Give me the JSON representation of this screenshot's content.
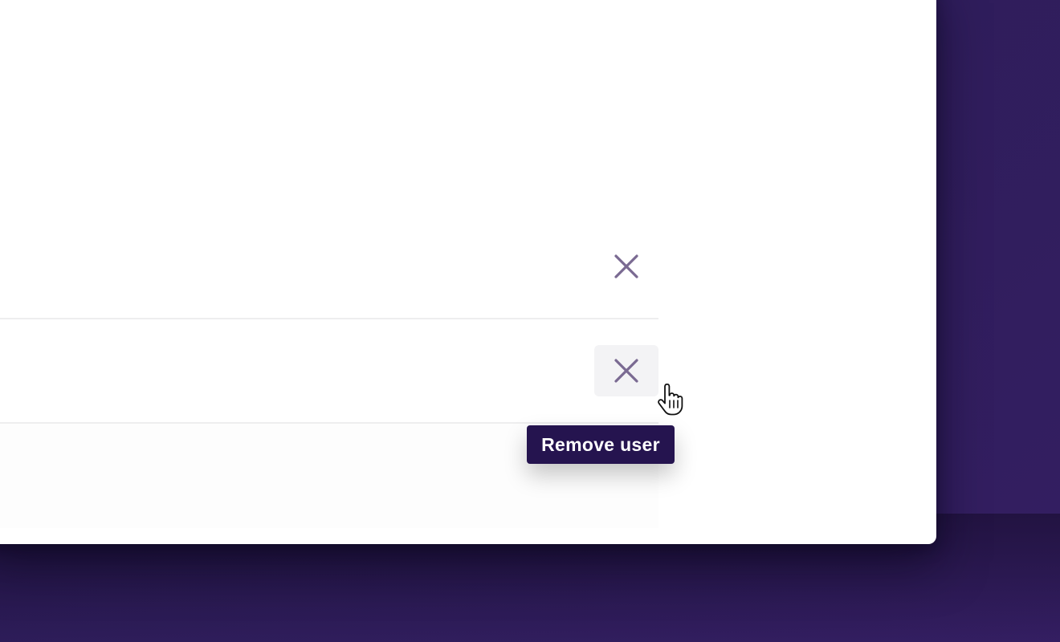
{
  "users_list": {
    "rows": [
      {
        "remove_icon": "close-icon"
      },
      {
        "remove_icon": "close-icon",
        "hovered": true
      }
    ]
  },
  "tooltip": {
    "text": "Remove user"
  },
  "colors": {
    "background": "#2e1d5a",
    "panel": "#ffffff",
    "icon": "#7a6a92",
    "hover_bg": "#f3f3f5",
    "tooltip_bg": "#25144f",
    "tooltip_text": "#ffffff",
    "divider": "#eeeeef"
  },
  "cursor": {
    "type": "pointer-hand-icon"
  }
}
